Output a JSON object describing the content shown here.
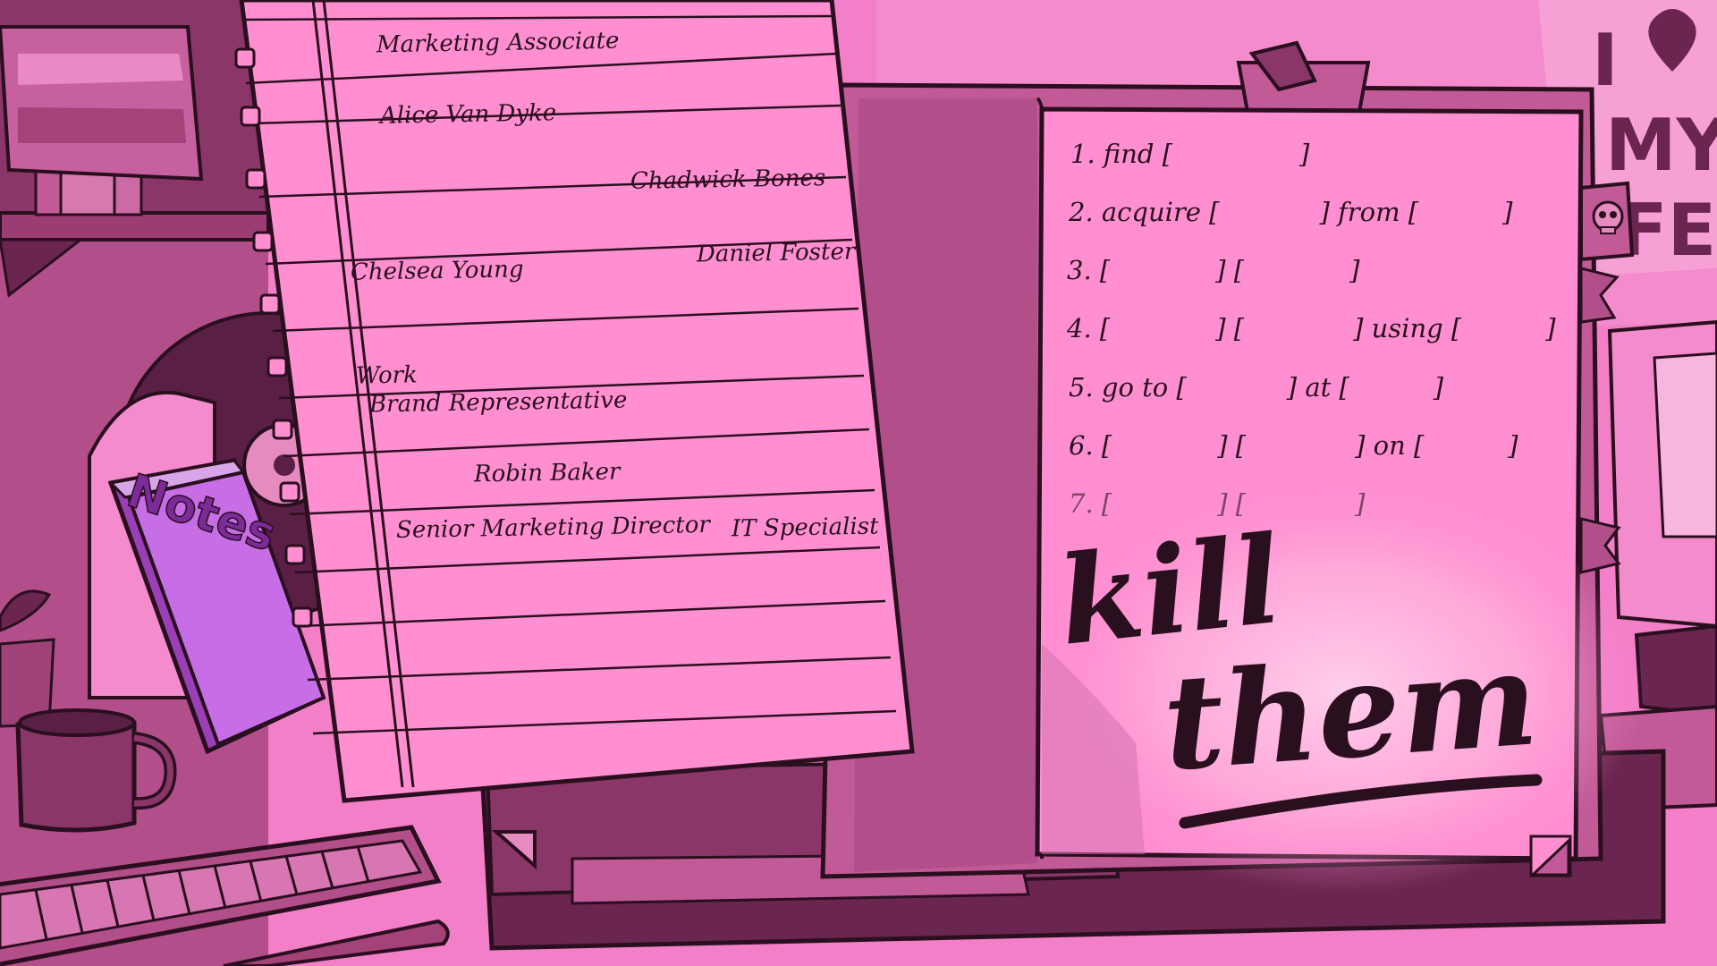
{
  "notepad": {
    "words": {
      "w1": "Marketing Associate",
      "w2": "Alice Van Dyke",
      "w3": "Chadwick Bones",
      "w4": "Daniel Foster",
      "w5": "Chelsea Young",
      "w6": "Work",
      "w7": "Brand Representative",
      "w8": "Robin Baker",
      "w9": "Senior Marketing Director",
      "w10": "IT Specialist"
    }
  },
  "journal": {
    "tasks": {
      "t1": {
        "num": "1.",
        "a": "find [",
        "b": "]"
      },
      "t2": {
        "num": "2.",
        "a": "acquire [",
        "b": "] from [",
        "c": "]"
      },
      "t3": {
        "num": "3.",
        "a": "[",
        "b": "] [",
        "c": "]"
      },
      "t4": {
        "num": "4.",
        "a": "[",
        "b": "] [",
        "c": "] using [",
        "d": "]"
      },
      "t5": {
        "num": "5.",
        "a": "go to [",
        "b": "] at [",
        "c": "]"
      },
      "t6": {
        "num": "6.",
        "a": "[",
        "b": "] [",
        "c": "] on [",
        "d": "]"
      },
      "t7": {
        "num": "7.",
        "a": "[",
        "b": "] [",
        "c": "]"
      }
    },
    "scrawl_line1": "kill",
    "scrawl_line2": "them"
  },
  "props": {
    "notes_book_label": "Notes",
    "poster_line1": "I",
    "poster_line2": "MY",
    "poster_line3": "FE"
  },
  "colors": {
    "background": "#f27fc7",
    "paper": "#ff8fd1",
    "ink": "#2a0f1f",
    "shadow": "#b74e8c",
    "dark": "#6a2550"
  }
}
